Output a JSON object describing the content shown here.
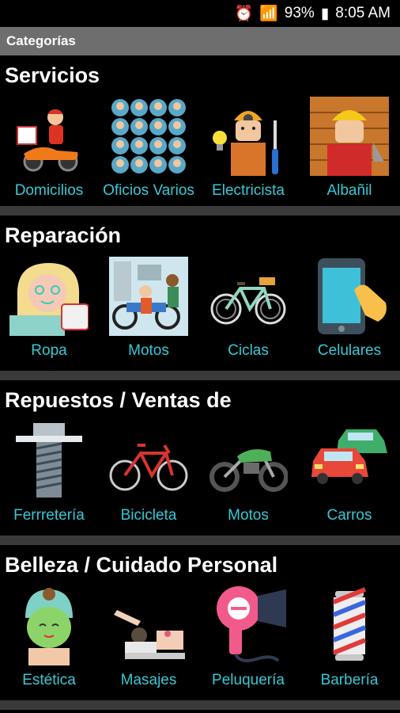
{
  "status_bar": {
    "battery": "93%",
    "time": "8:05 AM"
  },
  "app_bar": {
    "title": "Categorías"
  },
  "sections": [
    {
      "title": "Servicios",
      "items": [
        {
          "label": "Domicilios",
          "icon": "delivery-scooter-icon"
        },
        {
          "label": "Oficios Varios",
          "icon": "worker-avatars-grid-icon"
        },
        {
          "label": "Electricista",
          "icon": "electrician-icon"
        },
        {
          "label": "Albañil",
          "icon": "bricklayer-icon"
        }
      ]
    },
    {
      "title": "Reparación",
      "items": [
        {
          "label": "Ropa",
          "icon": "seamstress-icon"
        },
        {
          "label": "Motos",
          "icon": "motorcycle-repair-icon"
        },
        {
          "label": "Ciclas",
          "icon": "bicycle-icon"
        },
        {
          "label": "Celulares",
          "icon": "smartphone-touch-icon"
        }
      ]
    },
    {
      "title": "Repuestos / Ventas de",
      "items": [
        {
          "label": "Ferrretería",
          "icon": "bolt-icon"
        },
        {
          "label": "Bicicleta",
          "icon": "red-bicycle-icon"
        },
        {
          "label": "Motos",
          "icon": "dirt-bike-icon"
        },
        {
          "label": "Carros",
          "icon": "cars-icon"
        }
      ]
    },
    {
      "title": "Belleza / Cuidado Personal",
      "items": [
        {
          "label": "Estética",
          "icon": "face-mask-icon"
        },
        {
          "label": "Masajes",
          "icon": "massage-icon"
        },
        {
          "label": "Peluquería",
          "icon": "hair-dryer-icon"
        },
        {
          "label": "Barbería",
          "icon": "barber-pole-icon"
        }
      ]
    }
  ],
  "colors": {
    "label": "#36c9d6",
    "app_bar": "#6e6e6e",
    "divider": "#3a3a3a",
    "background": "#000000"
  }
}
